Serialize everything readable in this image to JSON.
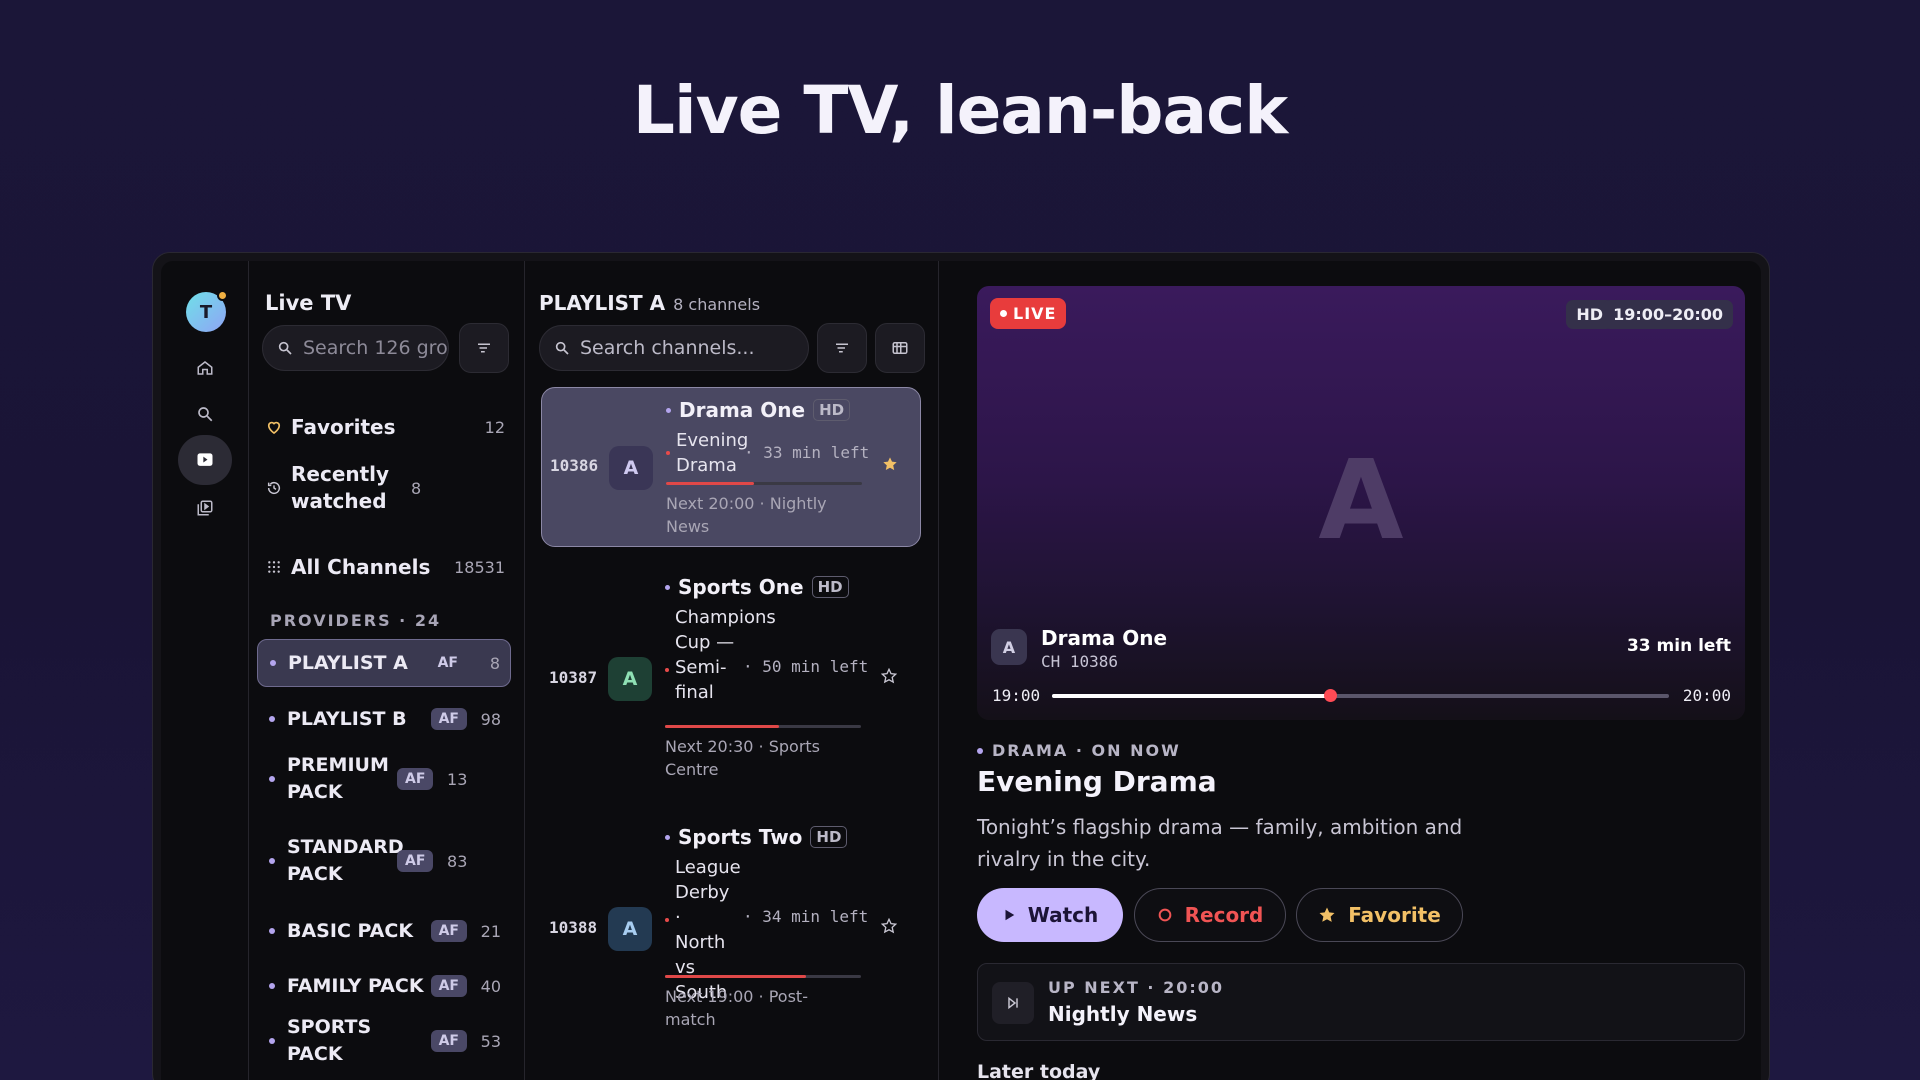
{
  "hero": {
    "title": "Live TV, lean-back"
  },
  "rail": {
    "avatar_initial": "T"
  },
  "groups": {
    "title": "Live TV",
    "search_placeholder": "Search 126 gro",
    "nav": [
      {
        "label": "Favorites",
        "count": "12",
        "icon": "heart-icon"
      },
      {
        "label": "Recently watched",
        "count": "8",
        "icon": "history-icon"
      },
      {
        "label": "All Channels",
        "count": "18531",
        "icon": "grid-icon"
      }
    ],
    "providers_heading": "PROVIDERS · 24",
    "providers": [
      {
        "name": "PLAYLIST A",
        "tag": "AF",
        "count": "8"
      },
      {
        "name": "PLAYLIST B",
        "tag": "AF",
        "count": "98"
      },
      {
        "name": "PREMIUM PACK",
        "tag": "AF",
        "count": "13"
      },
      {
        "name": "STANDARD PACK",
        "tag": "AF",
        "count": "83"
      },
      {
        "name": "BASIC PACK",
        "tag": "AF",
        "count": "21"
      },
      {
        "name": "FAMILY PACK",
        "tag": "AF",
        "count": "40"
      },
      {
        "name": "SPORTS PACK",
        "tag": "AF",
        "count": "53"
      }
    ]
  },
  "channels": {
    "title": "PLAYLIST A",
    "subtitle": "8 channels",
    "search_placeholder": "Search channels...",
    "items": [
      {
        "number": "10386",
        "logo": "A",
        "name": "Drama One",
        "quality": "HD",
        "program": "Evening Drama",
        "time_left": "· 33 min left",
        "progress": 0.45,
        "next": "Next 20:00 · Nightly News",
        "favorite": true
      },
      {
        "number": "10387",
        "logo": "A",
        "name": "Sports One",
        "quality": "HD",
        "program": "Champions Cup — Semi-final",
        "time_left": "· 50 min left",
        "progress": 0.58,
        "next": "Next 20:30 · Sports Centre",
        "favorite": false
      },
      {
        "number": "10388",
        "logo": "A",
        "name": "Sports Two",
        "quality": "HD",
        "program": "League Derby · North vs South",
        "time_left": "· 34 min left",
        "progress": 0.72,
        "next": "Next 19:00 · Post-match",
        "favorite": false
      }
    ]
  },
  "player": {
    "live_label": "LIVE",
    "quality": "HD",
    "slot": "19:00–20:00",
    "big_letter": "A",
    "logo": "A",
    "channel_name": "Drama One",
    "channel_number": "CH 10386",
    "time_left": "33 min left",
    "start": "19:00",
    "end": "20:00",
    "progress": 0.45,
    "genre": "DRAMA · ON NOW",
    "program_title": "Evening Drama",
    "description": "Tonight’s flagship drama — family, ambition and rivalry in the city.",
    "buttons": {
      "watch": "Watch",
      "record": "Record",
      "favorite": "Favorite"
    },
    "up_next_label": "UP NEXT · 20:00",
    "up_next_title": "Nightly News",
    "later_label": "Later today"
  },
  "colors": {
    "accent": "#c8b8ff",
    "live": "#e83c3c",
    "record": "#f05454",
    "favorite": "#f2c066"
  }
}
